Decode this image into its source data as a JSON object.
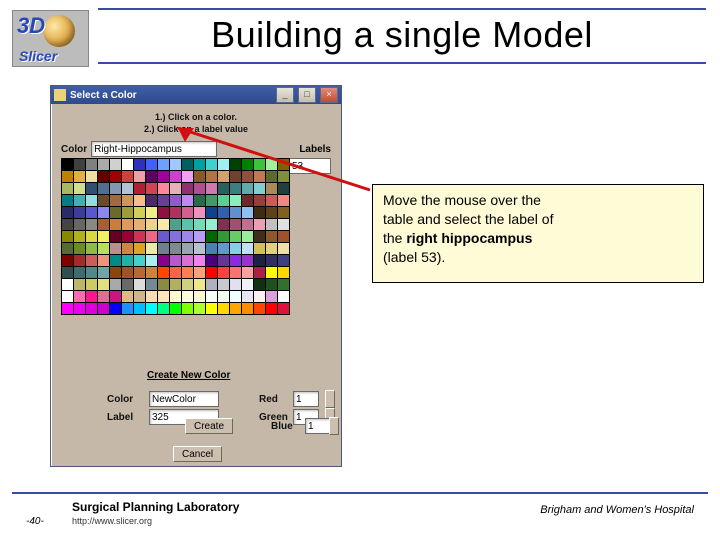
{
  "logo": {
    "top": "3D",
    "bottom": "Slicer"
  },
  "title": "Building a single Model",
  "dialog": {
    "title": "Select a Color",
    "instr_l1": "1.) Click on a color.",
    "instr_l2": "2.) Click on a label value",
    "color_label": "Color",
    "color_value": "Right-Hippocampus",
    "labels_header": "Labels",
    "labels_box_value": "53",
    "create_header": "Create New Color",
    "cnc_color_label": "Color",
    "cnc_color_value": "NewColor",
    "cnc_label_label": "Label",
    "cnc_label_value": "325",
    "red_label": "Red",
    "red_value": "1",
    "green_label": "Green",
    "green_value": "1",
    "blue_label": "Blue",
    "blue_value": "1",
    "create_btn": "Create",
    "cancel_btn": "Cancel"
  },
  "callout": {
    "l1": "Move the mouse over the",
    "l2": "table and select the label of",
    "l3_a": "the ",
    "l3_b": "right hippocampus",
    "l4": "(label 53)."
  },
  "footer": {
    "lab": "Surgical Planning Laboratory",
    "url": "http://www.slicer.org",
    "page": "-40-",
    "hospital": "Brigham and Women's Hospital"
  },
  "palette_rows": [
    [
      "#000000",
      "#404040",
      "#808080",
      "#aaaaaa",
      "#d0d0d0",
      "#ffffff",
      "#3030c0",
      "#4060ff",
      "#70a0ff",
      "#a0c8ff",
      "#006060",
      "#00a0a0",
      "#40d0d0",
      "#a0f0f0",
      "#004000",
      "#008000",
      "#40c040",
      "#a0f0a0",
      "#806000"
    ],
    [
      "#c08000",
      "#e0b040",
      "#f0e0a0",
      "#600000",
      "#a00000",
      "#d04040",
      "#f0a0a0",
      "#600060",
      "#a000a0",
      "#d040d0",
      "#f0a0f0",
      "#8b572a",
      "#b07448",
      "#d4a070",
      "#704030",
      "#905040",
      "#c07858",
      "#5a6a30",
      "#7f8f40"
    ],
    [
      "#a8b860",
      "#d0e090",
      "#305070",
      "#507090",
      "#8098b0",
      "#b0c4d8",
      "#b02030",
      "#d04454",
      "#ff889a",
      "#e8b0b8",
      "#903070",
      "#b05090",
      "#d078b0",
      "#2a6060",
      "#3a8080",
      "#5faaaa",
      "#80d0d0",
      "#aa8a5a",
      "#204040"
    ],
    [
      "#008080",
      "#40b0b0",
      "#90e0e0",
      "#6a4a2a",
      "#a06c3c",
      "#d09458",
      "#f0c088",
      "#4a2a6a",
      "#6a3c9c",
      "#9458d0",
      "#c088f0",
      "#2a6a4a",
      "#3c9c6a",
      "#58d094",
      "#88f0c0",
      "#6a2a2a",
      "#9c3c3c",
      "#d05858",
      "#f08888"
    ],
    [
      "#2a2a6a",
      "#3c3c9c",
      "#5858d0",
      "#8888f0",
      "#6a6a2a",
      "#9c9c3c",
      "#d0d058",
      "#f0f088",
      "#901040",
      "#b03060",
      "#d06090",
      "#f090c0",
      "#104090",
      "#3060b0",
      "#6090d0",
      "#90c0f0",
      "#402a10",
      "#604018",
      "#806020"
    ],
    [
      "#444444",
      "#666666",
      "#888888",
      "#a46030",
      "#cc7c40",
      "#e0985c",
      "#e8b070",
      "#f0d090",
      "#f8e8b0",
      "#50a090",
      "#60c0a8",
      "#78d8b8",
      "#a0e8d0",
      "#803050",
      "#a05070",
      "#c07090",
      "#e8a0b4",
      "#c0c0c0",
      "#e0e0e0"
    ],
    [
      "#888800",
      "#b0b020",
      "#d8d840",
      "#f0f060",
      "#660022",
      "#990033",
      "#cc3355",
      "#ee6688",
      "#6a5acd",
      "#8470dd",
      "#9e86ee",
      "#b89cfa",
      "#006600",
      "#339933",
      "#66cc66",
      "#99ee99",
      "#422c1a",
      "#8b5a2b",
      "#a0522d"
    ],
    [
      "#556b2f",
      "#6b8e23",
      "#8fbc3f",
      "#b8e060",
      "#bc8f8f",
      "#cd853f",
      "#daa520",
      "#eee8aa",
      "#708090",
      "#808890",
      "#9aa4ac",
      "#b8c2cc",
      "#4682b4",
      "#5e9ad0",
      "#87ceeb",
      "#c0e0f6",
      "#d0c060",
      "#e0d080",
      "#f0e0a8"
    ],
    [
      "#800000",
      "#a52a2a",
      "#cd5c5c",
      "#e9967a",
      "#008b8b",
      "#20b2aa",
      "#48d1cc",
      "#afeeee",
      "#8b008b",
      "#ba55d3",
      "#da70d6",
      "#ee82ee",
      "#4b0082",
      "#663399",
      "#8a2be2",
      "#9932cc",
      "#202040",
      "#303060",
      "#404080"
    ],
    [
      "#2f4f4f",
      "#3d6c6c",
      "#528888",
      "#70a6a6",
      "#8b4513",
      "#a0522d",
      "#b86838",
      "#d28040",
      "#ff4500",
      "#ff6347",
      "#ff7f50",
      "#ffa07a",
      "#ff0000",
      "#ff4040",
      "#ff7070",
      "#ffa0a0",
      "#aa2244",
      "#ffff00",
      "#ffd700"
    ],
    [
      "#ffffff",
      "#bdb76b",
      "#cccc66",
      "#e0e080",
      "#a9a9a9",
      "#696969",
      "#dcdcdc",
      "#778899",
      "#8a8a40",
      "#b0b060",
      "#d0d080",
      "#f0e68c",
      "#b0b0c0",
      "#c8c8d0",
      "#e0e0f0",
      "#f0f0f8",
      "#103010",
      "#205020",
      "#307030"
    ],
    [
      "#ffffff",
      "#ff69b4",
      "#ff1493",
      "#db7093",
      "#c71585",
      "#deb887",
      "#d2b48c",
      "#f5deb3",
      "#ffe4b5",
      "#fffacd",
      "#ffffe0",
      "#fafad2",
      "#f5fffa",
      "#f0fff0",
      "#f0ffff",
      "#e6e6fa",
      "#fff0f5",
      "#dda0dd",
      "#ffffff"
    ],
    [
      "#ff00ff",
      "#ee00ee",
      "#dd00dd",
      "#cc00cc",
      "#0000ff",
      "#1e90ff",
      "#00bfff",
      "#00ffff",
      "#00ff7f",
      "#00ff00",
      "#7fff00",
      "#adff2f",
      "#ffff00",
      "#ffd700",
      "#ffa500",
      "#ff8c00",
      "#ff4500",
      "#ff0000",
      "#dc143c"
    ]
  ]
}
